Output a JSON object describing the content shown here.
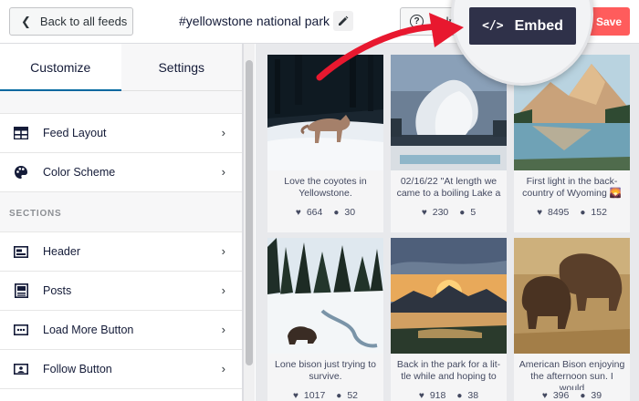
{
  "topbar": {
    "back_label": "Back to all feeds",
    "feed_title": "#yellowstone national park",
    "help_label": "Help",
    "embed_label": "Embed",
    "save_label": "Save"
  },
  "sidebar": {
    "tabs": [
      {
        "label": "Customize",
        "active": true
      },
      {
        "label": "Settings",
        "active": false
      }
    ],
    "items": [
      {
        "label": "Feed Layout",
        "icon": "grid-layout-icon"
      },
      {
        "label": "Color Scheme",
        "icon": "palette-icon"
      }
    ],
    "section_title": "SECTIONS",
    "section_items": [
      {
        "label": "Header",
        "icon": "header-icon"
      },
      {
        "label": "Posts",
        "icon": "posts-icon"
      },
      {
        "label": "Load More Button",
        "icon": "load-more-icon"
      },
      {
        "label": "Follow Button",
        "icon": "follow-icon"
      }
    ]
  },
  "feed": {
    "posts": [
      {
        "caption": "Love the coyotes in Yellowstone.",
        "likes": "664",
        "comments": "30",
        "image": "coyote in snow"
      },
      {
        "caption": "02/16/22 \"At length we came to a boiling Lake a",
        "likes": "230",
        "comments": "5",
        "image": "steaming geyser pool"
      },
      {
        "caption": "First light in the back-country of Wyoming 🌄",
        "likes": "8495",
        "comments": "152",
        "image": "mountain lake at sunrise"
      },
      {
        "caption": "Lone bison just trying to survive.",
        "likes": "1017",
        "comments": "52",
        "image": "bison in snowy forest"
      },
      {
        "caption": "Back in the park for a lit-tle while and hoping to",
        "likes": "918",
        "comments": "38",
        "image": "sunset over river and mountains"
      },
      {
        "caption": "American Bison enjoying the afternoon sun. I would",
        "likes": "396",
        "comments": "39",
        "image": "two bison in golden grass"
      }
    ]
  },
  "colors": {
    "embed": "#2f3149",
    "save": "#ff5c5c",
    "arrow": "#e8182f",
    "tab_underline": "#0068a0"
  }
}
